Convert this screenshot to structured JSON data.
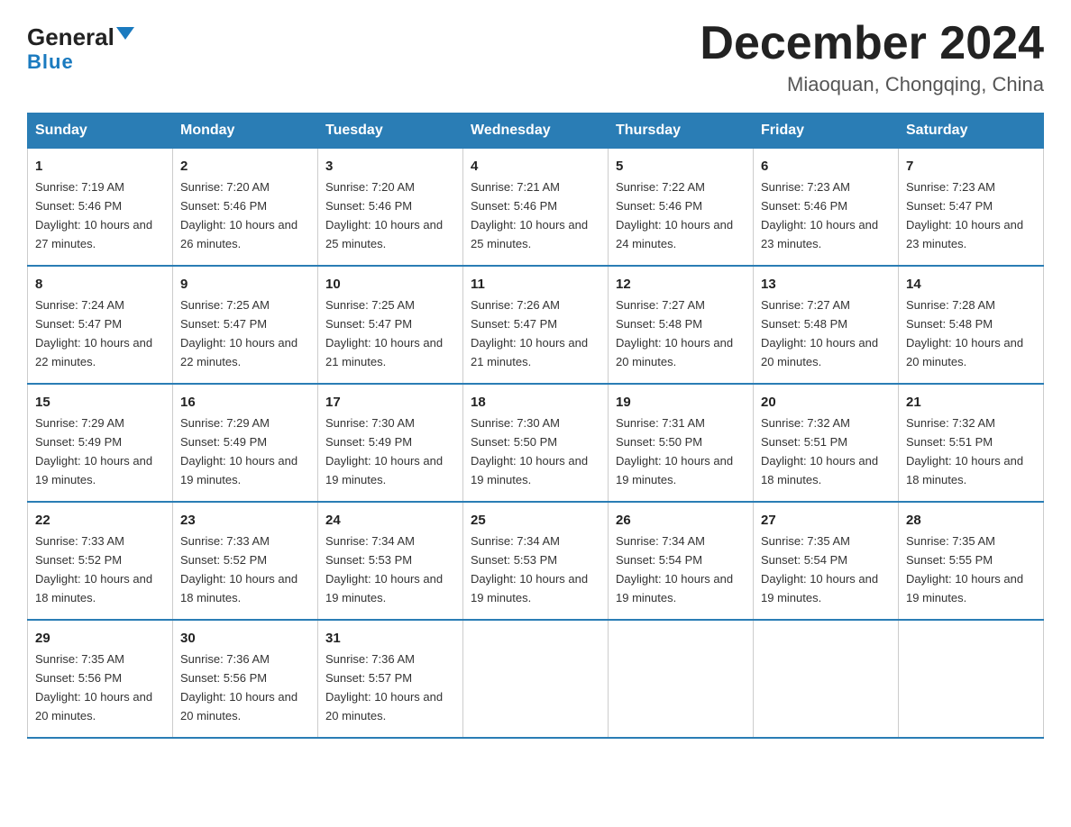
{
  "logo": {
    "general": "General",
    "blue": "Blue"
  },
  "title": "December 2024",
  "subtitle": "Miaoquan, Chongqing, China",
  "days_of_week": [
    "Sunday",
    "Monday",
    "Tuesday",
    "Wednesday",
    "Thursday",
    "Friday",
    "Saturday"
  ],
  "weeks": [
    [
      {
        "day": "1",
        "sunrise": "7:19 AM",
        "sunset": "5:46 PM",
        "daylight": "10 hours and 27 minutes."
      },
      {
        "day": "2",
        "sunrise": "7:20 AM",
        "sunset": "5:46 PM",
        "daylight": "10 hours and 26 minutes."
      },
      {
        "day": "3",
        "sunrise": "7:20 AM",
        "sunset": "5:46 PM",
        "daylight": "10 hours and 25 minutes."
      },
      {
        "day": "4",
        "sunrise": "7:21 AM",
        "sunset": "5:46 PM",
        "daylight": "10 hours and 25 minutes."
      },
      {
        "day": "5",
        "sunrise": "7:22 AM",
        "sunset": "5:46 PM",
        "daylight": "10 hours and 24 minutes."
      },
      {
        "day": "6",
        "sunrise": "7:23 AM",
        "sunset": "5:46 PM",
        "daylight": "10 hours and 23 minutes."
      },
      {
        "day": "7",
        "sunrise": "7:23 AM",
        "sunset": "5:47 PM",
        "daylight": "10 hours and 23 minutes."
      }
    ],
    [
      {
        "day": "8",
        "sunrise": "7:24 AM",
        "sunset": "5:47 PM",
        "daylight": "10 hours and 22 minutes."
      },
      {
        "day": "9",
        "sunrise": "7:25 AM",
        "sunset": "5:47 PM",
        "daylight": "10 hours and 22 minutes."
      },
      {
        "day": "10",
        "sunrise": "7:25 AM",
        "sunset": "5:47 PM",
        "daylight": "10 hours and 21 minutes."
      },
      {
        "day": "11",
        "sunrise": "7:26 AM",
        "sunset": "5:47 PM",
        "daylight": "10 hours and 21 minutes."
      },
      {
        "day": "12",
        "sunrise": "7:27 AM",
        "sunset": "5:48 PM",
        "daylight": "10 hours and 20 minutes."
      },
      {
        "day": "13",
        "sunrise": "7:27 AM",
        "sunset": "5:48 PM",
        "daylight": "10 hours and 20 minutes."
      },
      {
        "day": "14",
        "sunrise": "7:28 AM",
        "sunset": "5:48 PM",
        "daylight": "10 hours and 20 minutes."
      }
    ],
    [
      {
        "day": "15",
        "sunrise": "7:29 AM",
        "sunset": "5:49 PM",
        "daylight": "10 hours and 19 minutes."
      },
      {
        "day": "16",
        "sunrise": "7:29 AM",
        "sunset": "5:49 PM",
        "daylight": "10 hours and 19 minutes."
      },
      {
        "day": "17",
        "sunrise": "7:30 AM",
        "sunset": "5:49 PM",
        "daylight": "10 hours and 19 minutes."
      },
      {
        "day": "18",
        "sunrise": "7:30 AM",
        "sunset": "5:50 PM",
        "daylight": "10 hours and 19 minutes."
      },
      {
        "day": "19",
        "sunrise": "7:31 AM",
        "sunset": "5:50 PM",
        "daylight": "10 hours and 19 minutes."
      },
      {
        "day": "20",
        "sunrise": "7:32 AM",
        "sunset": "5:51 PM",
        "daylight": "10 hours and 18 minutes."
      },
      {
        "day": "21",
        "sunrise": "7:32 AM",
        "sunset": "5:51 PM",
        "daylight": "10 hours and 18 minutes."
      }
    ],
    [
      {
        "day": "22",
        "sunrise": "7:33 AM",
        "sunset": "5:52 PM",
        "daylight": "10 hours and 18 minutes."
      },
      {
        "day": "23",
        "sunrise": "7:33 AM",
        "sunset": "5:52 PM",
        "daylight": "10 hours and 18 minutes."
      },
      {
        "day": "24",
        "sunrise": "7:34 AM",
        "sunset": "5:53 PM",
        "daylight": "10 hours and 19 minutes."
      },
      {
        "day": "25",
        "sunrise": "7:34 AM",
        "sunset": "5:53 PM",
        "daylight": "10 hours and 19 minutes."
      },
      {
        "day": "26",
        "sunrise": "7:34 AM",
        "sunset": "5:54 PM",
        "daylight": "10 hours and 19 minutes."
      },
      {
        "day": "27",
        "sunrise": "7:35 AM",
        "sunset": "5:54 PM",
        "daylight": "10 hours and 19 minutes."
      },
      {
        "day": "28",
        "sunrise": "7:35 AM",
        "sunset": "5:55 PM",
        "daylight": "10 hours and 19 minutes."
      }
    ],
    [
      {
        "day": "29",
        "sunrise": "7:35 AM",
        "sunset": "5:56 PM",
        "daylight": "10 hours and 20 minutes."
      },
      {
        "day": "30",
        "sunrise": "7:36 AM",
        "sunset": "5:56 PM",
        "daylight": "10 hours and 20 minutes."
      },
      {
        "day": "31",
        "sunrise": "7:36 AM",
        "sunset": "5:57 PM",
        "daylight": "10 hours and 20 minutes."
      },
      null,
      null,
      null,
      null
    ]
  ]
}
